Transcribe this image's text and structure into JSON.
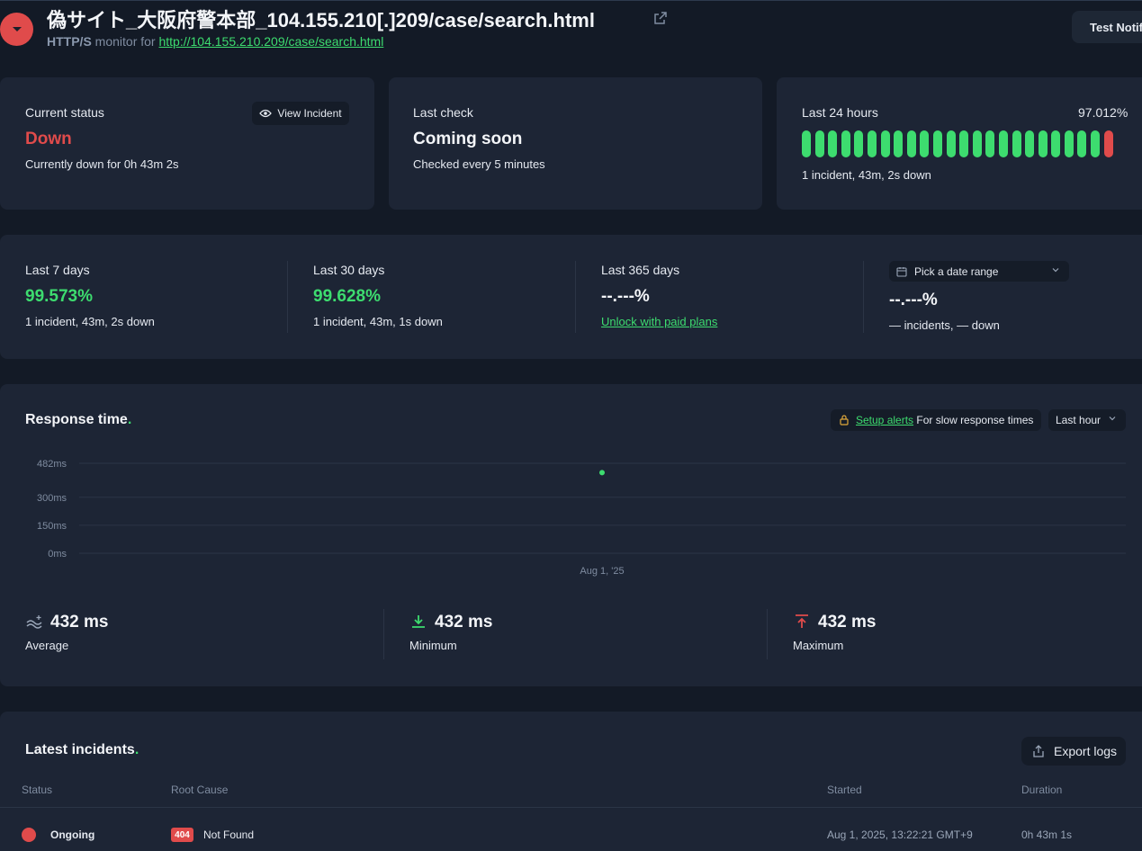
{
  "header": {
    "title": "偽サイト_大阪府警本部_104.155.210[.]209/case/search.html",
    "protocol": "HTTP/S",
    "monitor_for": "monitor for",
    "url": "http://104.155.210.209/case/search.html",
    "test_button": "Test Notification"
  },
  "current_status": {
    "label": "Current status",
    "value": "Down",
    "detail": "Currently down for 0h 43m 2s",
    "view_incident": "View Incident"
  },
  "last_check": {
    "label": "Last check",
    "value": "Coming soon",
    "detail": "Checked every 5 minutes"
  },
  "last_24": {
    "label": "Last 24 hours",
    "percent": "97.012%",
    "detail": "1 incident, 43m, 2s down",
    "bars": [
      "up",
      "up",
      "up",
      "up",
      "up",
      "up",
      "up",
      "up",
      "up",
      "up",
      "up",
      "up",
      "up",
      "up",
      "up",
      "up",
      "up",
      "up",
      "up",
      "up",
      "up",
      "up",
      "up",
      "down"
    ]
  },
  "periods": {
    "d7": {
      "label": "Last 7 days",
      "value": "99.573%",
      "detail": "1 incident, 43m, 2s down"
    },
    "d30": {
      "label": "Last 30 days",
      "value": "99.628%",
      "detail": "1 incident, 43m, 1s down"
    },
    "d365": {
      "label": "Last 365 days",
      "value": "--.---%",
      "detail": "Unlock with paid plans"
    },
    "custom": {
      "button": "Pick a date range",
      "value": "--.---%",
      "detail": "— incidents, — down"
    }
  },
  "response": {
    "title": "Response time",
    "setup_alerts": "Setup alerts",
    "alerts_suffix": "For slow response times",
    "range": "Last hour",
    "average_value": "432 ms",
    "average_label": "Average",
    "minimum_value": "432 ms",
    "minimum_label": "Minimum",
    "maximum_value": "432 ms",
    "maximum_label": "Maximum"
  },
  "chart_data": {
    "type": "scatter",
    "title": "Response time",
    "ytick_labels": [
      "482ms",
      "300ms",
      "150ms",
      "0ms"
    ],
    "ytick_values": [
      482,
      300,
      150,
      0
    ],
    "ylim": [
      0,
      482
    ],
    "xtick_labels": [
      "Aug 1, '25"
    ],
    "points": [
      {
        "x": "Aug 1, '25",
        "y": 432
      }
    ],
    "grid": true,
    "colors": {
      "point": "#3ddc6f",
      "grid": "#2b3546"
    }
  },
  "incidents": {
    "title": "Latest incidents",
    "export": "Export logs",
    "columns": {
      "status": "Status",
      "root_cause": "Root Cause",
      "started": "Started",
      "duration": "Duration"
    },
    "rows": [
      {
        "status": "Ongoing",
        "code": "404",
        "cause": "Not Found",
        "started": "Aug 1, 2025, 13:22:21 GMT+9",
        "duration": "0h 43m 1s"
      }
    ]
  },
  "colors": {
    "accent": "#3ddc6f",
    "down": "#e04b4b",
    "background": "#131a26",
    "card": "#1d2535"
  },
  "icons": [
    "chevron-down-icon",
    "external-link-icon",
    "bell-icon",
    "eye-icon",
    "calendar-icon",
    "lock-icon",
    "average-icon",
    "minimum-icon",
    "maximum-icon",
    "export-icon"
  ]
}
